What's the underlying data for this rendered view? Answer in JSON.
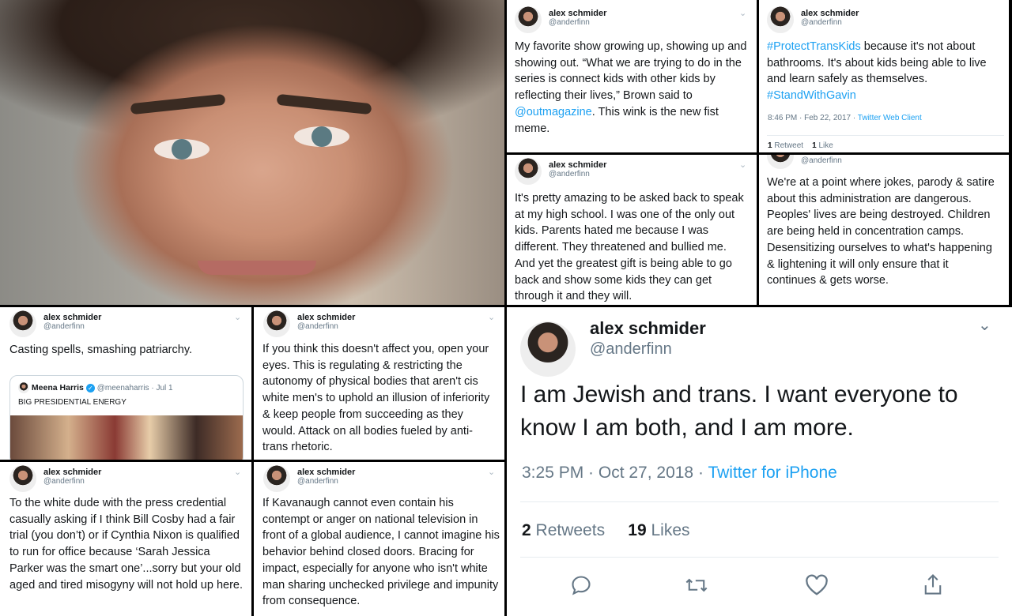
{
  "user": {
    "name": "alex schmider",
    "handle": "@anderfinn"
  },
  "tweets": [
    {
      "text_a": "My favorite show growing up, showing up and showing out. “What we are trying to do in the series is connect kids with other kids by reflecting their lives,” Brown said to ",
      "link": "@outmagazine",
      "text_b": ". This wink is the new fist meme."
    },
    {
      "tag1": "#ProtectTransKids",
      "text": " because it's not about bathrooms. It's about kids being able to live and learn safely as themselves.",
      "tag2": "#StandWithGavin",
      "time": "8:46 PM · Feb 22, 2017",
      "client": "Twitter Web Client",
      "retweets": "1",
      "retweets_label": "Retweet",
      "likes": "1",
      "likes_label": "Like"
    },
    {
      "text": "It's pretty amazing to be asked back to speak at my high school. I was one of the only out kids. Parents hated me because I was different. They threatened and bullied me. And yet the greatest gift is being able to go back and show some kids they can get through it and they will."
    },
    {
      "text": "We're at a point where jokes, parody & satire about this administration are dangerous. Peoples' lives are being destroyed. Children are being held in concentration camps. Desensitizing ourselves to what's happening & lightening it will only ensure that it continues & gets worse."
    },
    {
      "text": "Casting spells, smashing patriarchy.",
      "quote": {
        "name": "Meena Harris",
        "handle": "@meenaharris",
        "date": "· Jul 1",
        "text": "BIG PRESIDENTIAL ENERGY"
      }
    },
    {
      "text": "If you think this doesn't affect you, open your eyes. This is regulating & restricting the autonomy of physical bodies that aren't cis white men's to uphold an illusion of inferiority & keep people from succeeding as they would. Attack on all bodies fueled by anti-trans rhetoric."
    },
    {
      "text": "To the white dude with the press credential casually asking if I think Bill Cosby had a fair trial (you don’t) or if Cynthia Nixon is qualified to run for office because ‘Sarah Jessica Parker was the smart one’...sorry but your old aged and tired misogyny will not hold up here."
    },
    {
      "text": "If Kavanaugh cannot even contain his contempt or anger on national television in front of a global audience, I cannot imagine his behavior behind closed doors. Bracing for impact, especially for anyone who isn't white man sharing unchecked privilege and impunity from consequence."
    }
  ],
  "main": {
    "text": "I am Jewish and trans. I want everyone to know I am both, and I am more.",
    "time": "3:25 PM · Oct 27, 2018",
    "dot": "·",
    "client": "Twitter for iPhone",
    "retweets": "2",
    "retweets_label": "Retweets",
    "likes": "19",
    "likes_label": "Likes"
  },
  "icons": {
    "reply": "reply-icon",
    "retweet": "retweet-icon",
    "like": "heart-icon",
    "share": "share-icon",
    "menu": "chevron-down-icon"
  },
  "colors": {
    "link": "#1da1f2",
    "secondary": "#657786",
    "text": "#14171a",
    "divider": "#000000"
  }
}
